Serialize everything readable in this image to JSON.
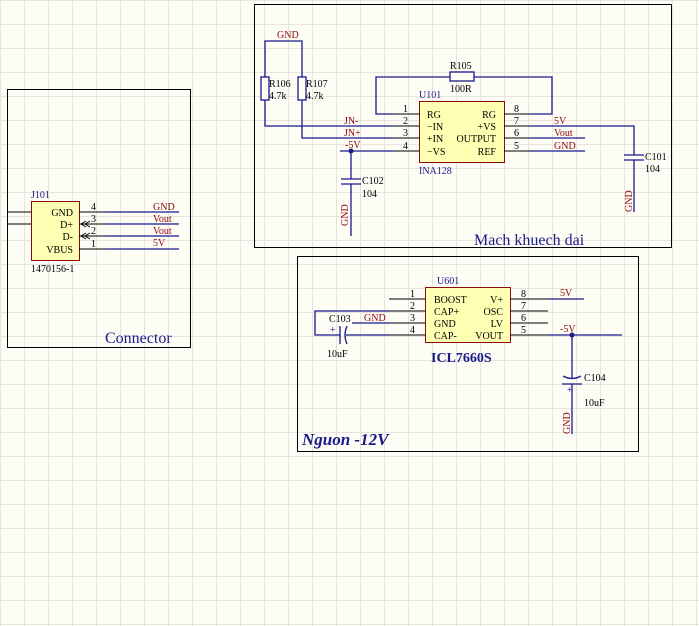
{
  "connector": {
    "title": "Connector",
    "designator": "J101",
    "part": "1470156-1",
    "pins": [
      {
        "num": "4",
        "name": "GND",
        "net": "GND"
      },
      {
        "num": "3",
        "name": "D+",
        "net": "Vout"
      },
      {
        "num": "2",
        "name": "D-",
        "net": "Vout"
      },
      {
        "num": "1",
        "name": "VBUS",
        "net": "5V"
      }
    ]
  },
  "amplifier": {
    "title": "Mach khuech dai",
    "designator": "U101",
    "part": "INA128",
    "left_pins": [
      {
        "num": "1",
        "name": "RG"
      },
      {
        "num": "2",
        "name": "−IN"
      },
      {
        "num": "3",
        "name": "+IN"
      },
      {
        "num": "4",
        "name": "−VS"
      }
    ],
    "right_pins": [
      {
        "num": "8",
        "name": "RG"
      },
      {
        "num": "7",
        "name": "+VS"
      },
      {
        "num": "6",
        "name": "OUTPUT"
      },
      {
        "num": "5",
        "name": "REF"
      }
    ],
    "nets": {
      "gnd_top": "GND",
      "jn_minus": "JN-",
      "jn_plus": "JN+",
      "minus5v": "-5V",
      "v5": "5V",
      "vout": "Vout",
      "gnd_right": "GND",
      "gnd_c102": "GND",
      "gnd_c101": "GND"
    },
    "r105": {
      "designator": "R105",
      "value": "100R"
    },
    "r106": {
      "designator": "R106",
      "value": "4.7k"
    },
    "r107": {
      "designator": "R107",
      "value": "4.7k"
    },
    "c101": {
      "designator": "C101",
      "value": "104"
    },
    "c102": {
      "designator": "C102",
      "value": "104"
    }
  },
  "power": {
    "title": "Nguon -12V",
    "designator": "U601",
    "part": "ICL7660S",
    "left_pins": [
      {
        "num": "1",
        "name": "BOOST"
      },
      {
        "num": "2",
        "name": "CAP+"
      },
      {
        "num": "3",
        "name": "GND"
      },
      {
        "num": "4",
        "name": "CAP-"
      }
    ],
    "right_pins": [
      {
        "num": "8",
        "name": "V+"
      },
      {
        "num": "7",
        "name": "OSC"
      },
      {
        "num": "6",
        "name": "LV"
      },
      {
        "num": "5",
        "name": "VOUT"
      }
    ],
    "nets": {
      "v5": "5V",
      "minus5v": "-5V",
      "gnd_left": "GND",
      "gnd_c104": "GND"
    },
    "c103": {
      "designator": "C103",
      "value": "10uF",
      "polarity": "+"
    },
    "c104": {
      "designator": "C104",
      "value": "10uF",
      "polarity": "+"
    }
  }
}
